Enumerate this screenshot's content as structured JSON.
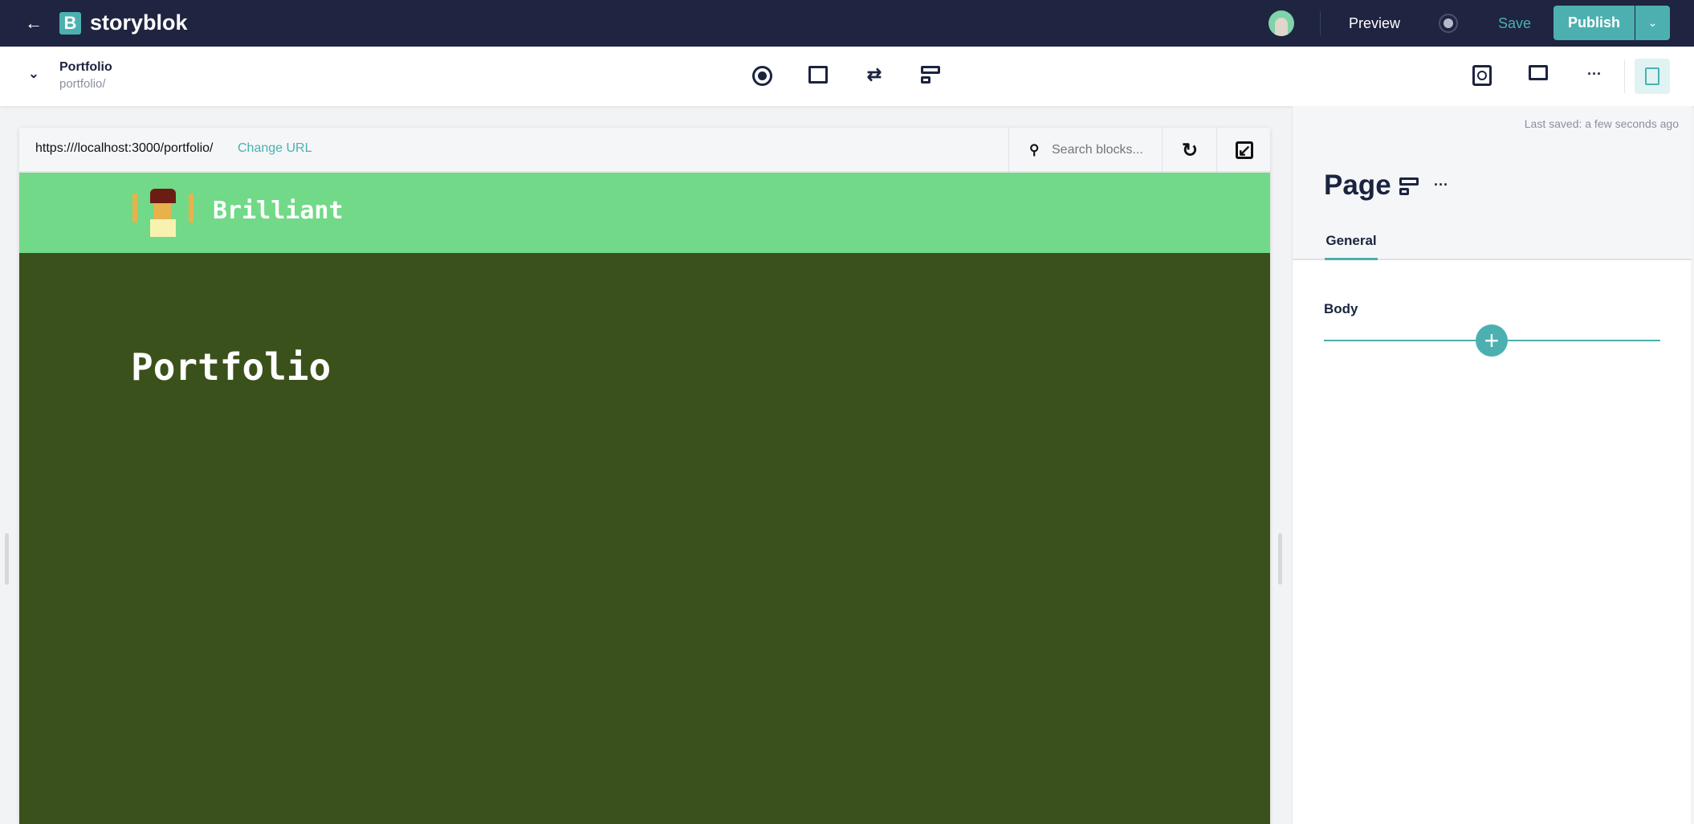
{
  "topbar": {
    "brand": "storyblok",
    "preview_label": "Preview",
    "save_label": "Save",
    "publish_label": "Publish"
  },
  "toolbar": {
    "story_name": "Portfolio",
    "story_slug": "portfolio/"
  },
  "preview": {
    "url": "https:///localhost:3000/portfolio/",
    "change_url_label": "Change URL",
    "search_placeholder": "Search blocks...",
    "site_brand": "Brilliant",
    "page_heading": "Portfolio"
  },
  "panel": {
    "last_saved": "Last saved: a few seconds ago",
    "title": "Page",
    "tabs": [
      {
        "label": "General",
        "active": true
      }
    ],
    "field_label": "Body"
  },
  "colors": {
    "accent": "#4cb0b0",
    "topbar": "#1f2440",
    "site_header": "#71d987",
    "site_body": "#3b511b"
  }
}
